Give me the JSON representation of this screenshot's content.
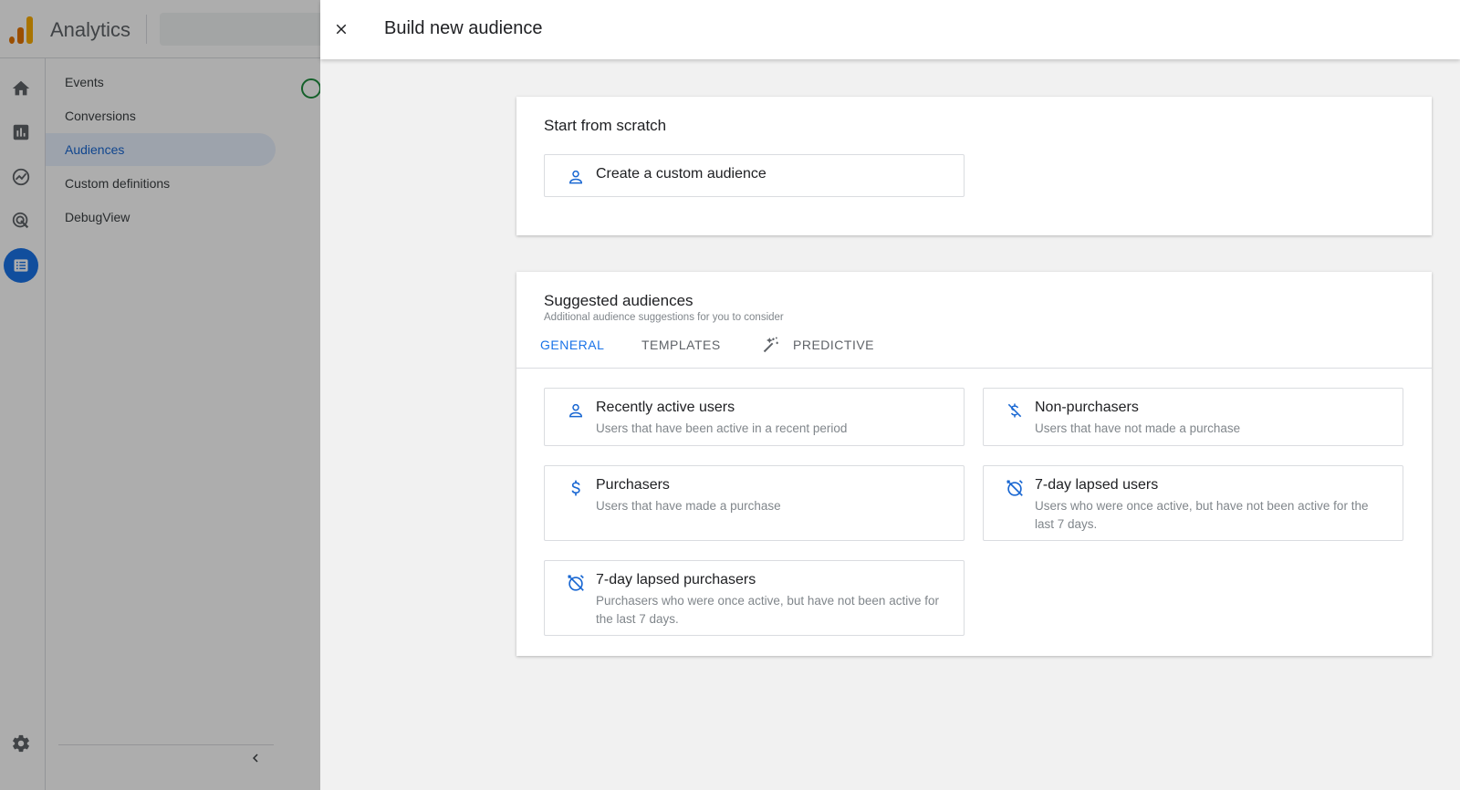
{
  "app": {
    "title": "Analytics"
  },
  "nav": {
    "items": [
      {
        "label": "Events"
      },
      {
        "label": "Conversions"
      },
      {
        "label": "Audiences",
        "active": true
      },
      {
        "label": "Custom definitions"
      },
      {
        "label": "DebugView"
      }
    ],
    "rail_icons": [
      "home-icon",
      "reports-icon",
      "explore-icon",
      "advertising-icon",
      "configure-icon"
    ],
    "settings_icon": "gear-icon",
    "collapse_icon": "chevron-left-icon"
  },
  "drawer": {
    "title": "Build new audience",
    "close_icon": "close-icon"
  },
  "scratch": {
    "title": "Start from scratch",
    "custom": {
      "title": "Create a custom audience",
      "icon": "person-icon"
    }
  },
  "suggested": {
    "title": "Suggested audiences",
    "subtitle": "Additional audience suggestions for you to consider",
    "tabs": [
      {
        "label": "GENERAL",
        "active": true
      },
      {
        "label": "TEMPLATES"
      },
      {
        "label": "PREDICTIVE",
        "icon": "magic-wand-icon"
      }
    ],
    "options": [
      {
        "title": "Recently active users",
        "desc": "Users that have been active in a recent period",
        "icon": "person-icon"
      },
      {
        "title": "Non-purchasers",
        "desc": "Users that have not made a purchase",
        "icon": "no-money-icon"
      },
      {
        "title": "Purchasers",
        "desc": "Users that have made a purchase",
        "icon": "dollar-icon"
      },
      {
        "title": "7-day lapsed users",
        "desc": "Users who were once active, but have not been active for the last 7 days.",
        "icon": "alarm-off-icon"
      },
      {
        "title": "7-day lapsed purchasers",
        "desc": "Purchasers who were once active, but have not been active for the last 7 days.",
        "icon": "alarm-off-icon"
      }
    ]
  },
  "colors": {
    "accent": "#1a73e8",
    "icon_blue": "#1967d2",
    "brand_orange": "#e37400",
    "brand_yellow": "#f9ab00"
  }
}
